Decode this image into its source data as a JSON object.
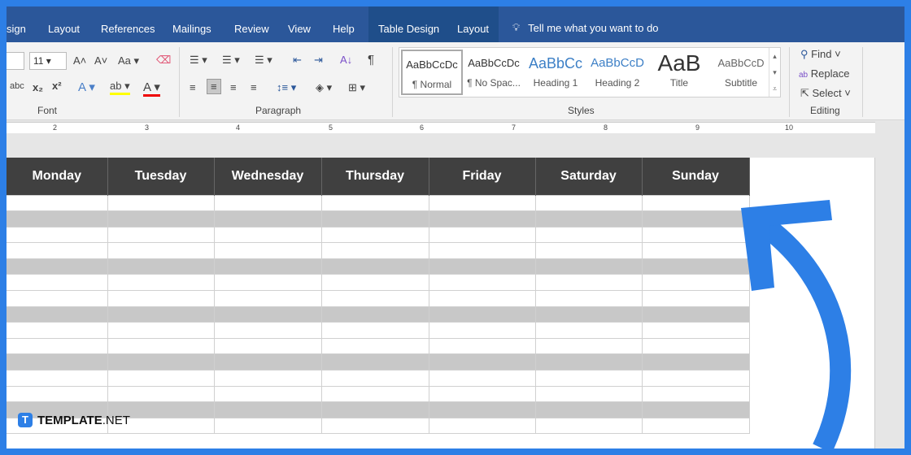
{
  "tabs": [
    "sign",
    "Layout",
    "References",
    "Mailings",
    "Review",
    "View",
    "Help",
    "Table Design",
    "Layout"
  ],
  "tell_me": "Tell me what you want to do",
  "font": {
    "size": "11",
    "group": "Font",
    "case": "Aa"
  },
  "paragraph": {
    "group": "Paragraph"
  },
  "styles": {
    "group": "Styles",
    "items": [
      {
        "preview": "AaBbCcDc",
        "name": "¶ Normal"
      },
      {
        "preview": "AaBbCcDc",
        "name": "¶ No Spac..."
      },
      {
        "preview": "AaBbCc",
        "name": "Heading 1"
      },
      {
        "preview": "AaBbCcD",
        "name": "Heading 2"
      },
      {
        "preview": "AaB",
        "name": "Title"
      },
      {
        "preview": "AaBbCcD",
        "name": "Subtitle"
      }
    ]
  },
  "editing": {
    "group": "Editing",
    "find": "Find",
    "replace": "Replace",
    "select": "Select"
  },
  "ruler": [
    "2",
    "3",
    "4",
    "5",
    "6",
    "7",
    "8",
    "9",
    "10"
  ],
  "table": {
    "headers": [
      "Monday",
      "Tuesday",
      "Wednesday",
      "Thursday",
      "Friday",
      "Saturday",
      "Sunday"
    ]
  },
  "logo": {
    "mark": "T",
    "text": "TEMPLATE",
    "suffix": ".NET"
  },
  "colors": {
    "frame": "#2d7fe6",
    "tabbar": "#2b579a",
    "header": "#404040",
    "stripe": "#c8c8c8"
  }
}
